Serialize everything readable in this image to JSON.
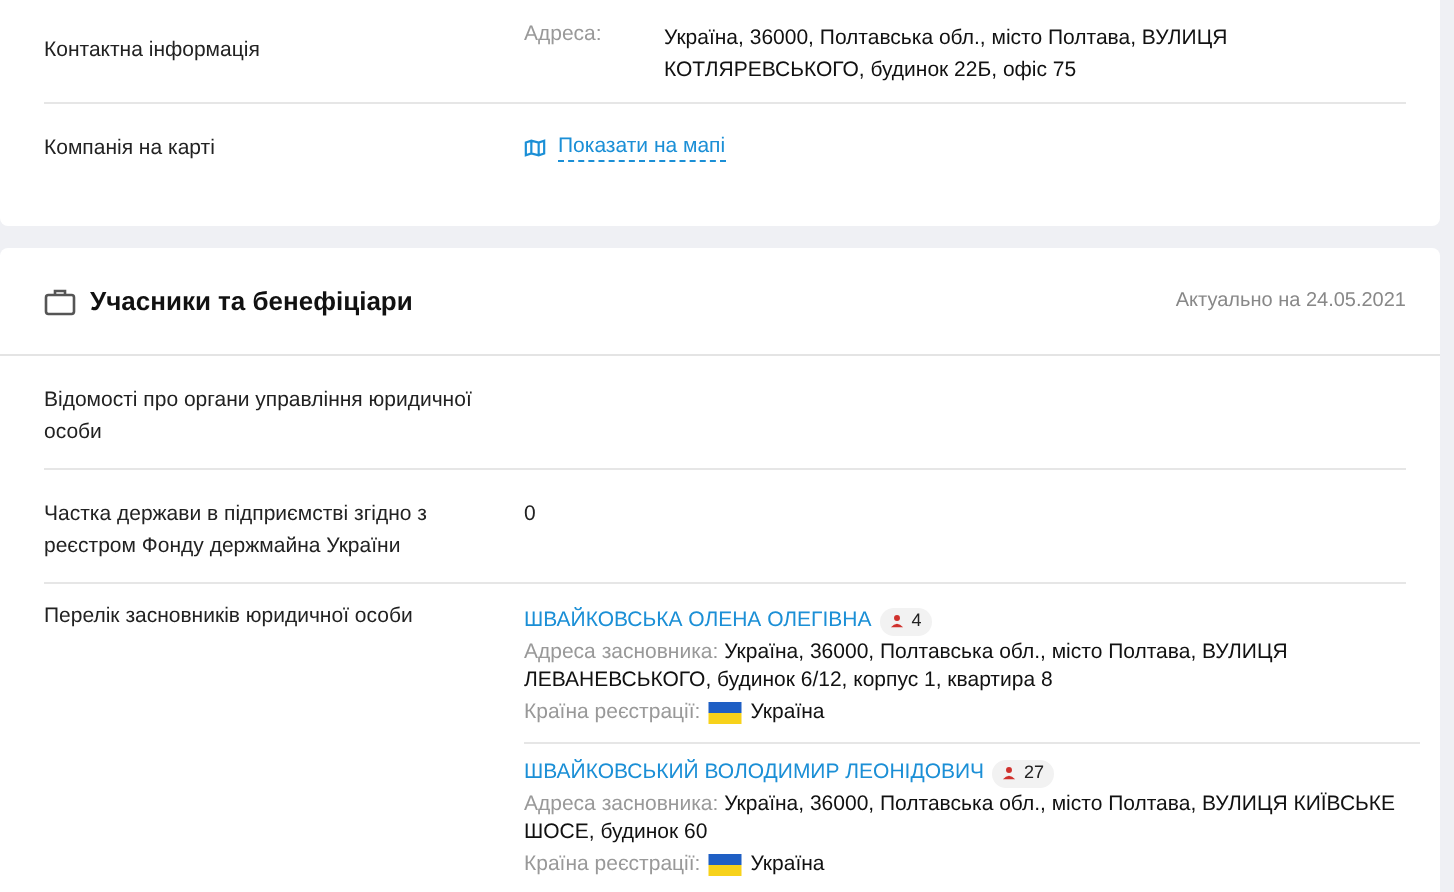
{
  "contact": {
    "label": "Контактна інформація",
    "address_label": "Адреса:",
    "address": "Україна, 36000, Полтавська обл., місто Полтава, ВУЛИЦЯ КОТЛЯРЕВСЬКОГО, будинок 22Б, офіс 75"
  },
  "map_row": {
    "label": "Компанія на карті",
    "link": "Показати на мапі"
  },
  "section": {
    "title": "Учасники та бенефіціари",
    "updated": "Актуально на 24.05.2021"
  },
  "rows": [
    {
      "label": "Відомості про органи управління юридичної особи"
    },
    {
      "label": "Частка держави в підприємстві згідно з реєстром Фонду держмайна України",
      "value": "0"
    }
  ],
  "founders": {
    "label": "Перелік засновників юридичної особи",
    "items": [
      {
        "name": "ШВАЙКОВСЬКА ОЛЕНА ОЛЕГІВНА",
        "count": "4",
        "address_label": "Адреса засновника:",
        "address": "Україна, 36000, Полтавська обл., місто Полтава, ВУЛИЦЯ ЛЕВАНЕВСЬКОГО, будинок 6/12, корпус 1, квартира 8",
        "country_label": "Країна реєстрації:",
        "country": "Україна"
      },
      {
        "name": "ШВАЙКОВСЬКИЙ ВОЛОДИМИР ЛЕОНІДОВИЧ",
        "count": "27",
        "address_label": "Адреса засновника:",
        "address": "Україна, 36000, Полтавська обл., місто Полтава, ВУЛИЦЯ КИЇВСЬКЕ ШОСЕ, будинок 60",
        "country_label": "Країна реєстрації:",
        "country": "Україна"
      }
    ]
  }
}
